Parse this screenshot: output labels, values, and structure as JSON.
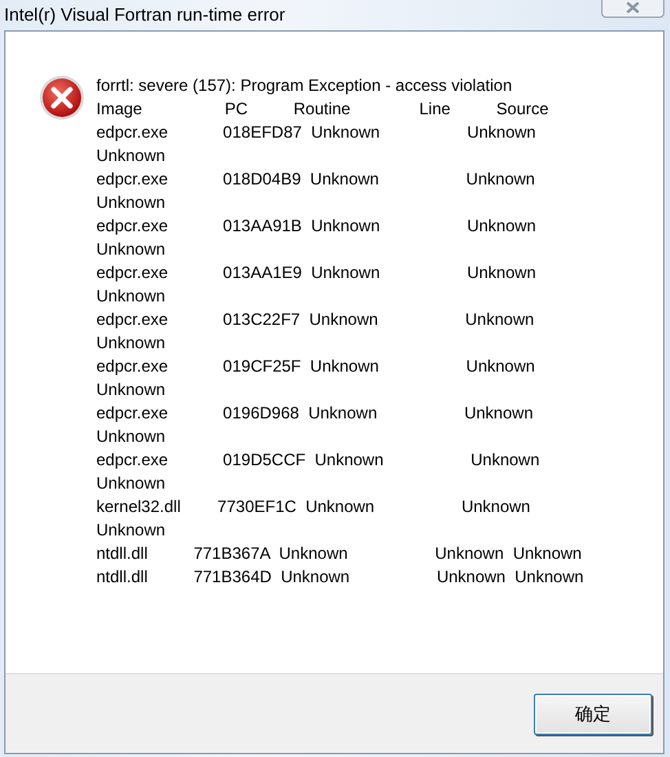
{
  "window": {
    "title": "Intel(r) Visual Fortran run-time error"
  },
  "message": {
    "heading": "forrtl: severe (157): Program Exception - access violation",
    "lines": [
      "Image                  PC          Routine               Line          Source",
      "edpcr.exe            018EFD87  Unknown                   Unknown",
      "Unknown",
      "edpcr.exe            018D04B9  Unknown                   Unknown",
      "Unknown",
      "edpcr.exe            013AA91B  Unknown                   Unknown",
      "Unknown",
      "edpcr.exe            013AA1E9  Unknown                   Unknown",
      "Unknown",
      "edpcr.exe            013C22F7  Unknown                   Unknown",
      "Unknown",
      "edpcr.exe            019CF25F  Unknown                   Unknown",
      "Unknown",
      "edpcr.exe            0196D968  Unknown                   Unknown",
      "Unknown",
      "edpcr.exe            019D5CCF  Unknown                   Unknown",
      "Unknown",
      "kernel32.dll        7730EF1C  Unknown                   Unknown",
      "Unknown",
      "ntdll.dll          771B367A  Unknown                   Unknown  Unknown",
      "ntdll.dll          771B364D  Unknown                   Unknown  Unknown"
    ]
  },
  "buttons": [
    {
      "label": "确定",
      "kind": "default"
    }
  ]
}
